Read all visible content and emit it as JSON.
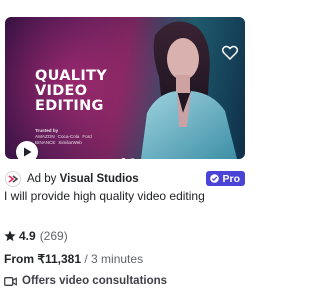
{
  "thumbnail": {
    "headline_lines": [
      "QUALITY",
      "VIDEO",
      "EDITING"
    ],
    "trusted_label": "Trusted by",
    "brands_row1": [
      "AMAZON",
      "Coca-Cola",
      "Ford"
    ],
    "brands_row2": [
      "BINANCE",
      "SimilarWeb"
    ],
    "slide_count": 2,
    "active_slide": 1
  },
  "seller": {
    "ad_prefix": "Ad by",
    "name": "Visual Studios",
    "badge": "Pro"
  },
  "gig": {
    "title": "I will provide high quality video editing"
  },
  "rating": {
    "value": "4.9",
    "count": "(269)"
  },
  "price": {
    "prefix": "From",
    "amount": "₹11,381",
    "duration": "/ 3 minutes"
  },
  "consultation": {
    "label": "Offers video consultations"
  },
  "colors": {
    "pro_badge": "#4a44d6",
    "text": "#222325",
    "muted": "#62646a"
  }
}
